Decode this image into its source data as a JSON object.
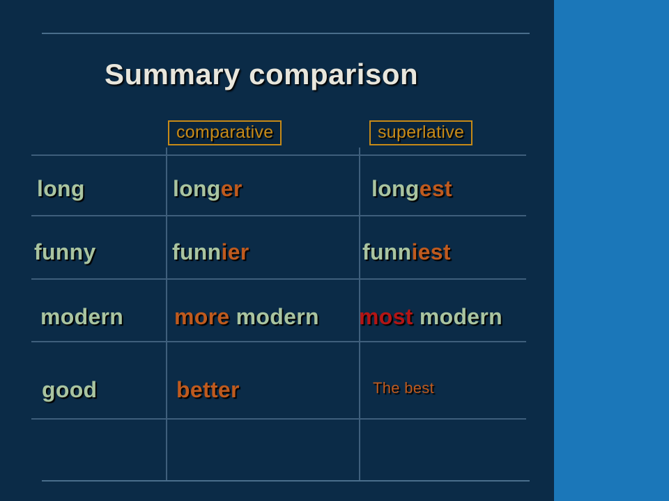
{
  "title": "Summary comparison",
  "headers": {
    "comparative": "comparative",
    "superlative": "superlative"
  },
  "rows": [
    {
      "adjective": "long",
      "comparative": {
        "base": "long",
        "suffix": "er"
      },
      "superlative": {
        "base": "long",
        "suffix": "est"
      }
    },
    {
      "adjective": "funny",
      "comparative": {
        "base": "funn",
        "suffix": "ier"
      },
      "superlative": {
        "base": "funn",
        "suffix": "iest"
      }
    },
    {
      "adjective": "modern",
      "comparative": {
        "prefix": "more",
        "word": "modern"
      },
      "superlative": {
        "prefix": "most",
        "word": "modern"
      }
    },
    {
      "adjective": "good",
      "comparative": {
        "full": "better"
      },
      "superlative": {
        "full": "The best"
      }
    }
  ]
}
